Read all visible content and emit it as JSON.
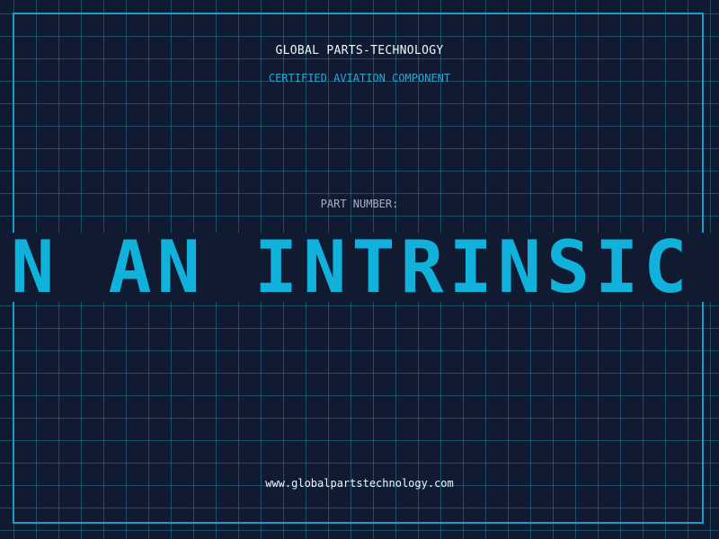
{
  "header": {
    "company": "GLOBAL PARTS-TECHNOLOGY",
    "subtitle": "CERTIFIED AVIATION COMPONENT"
  },
  "part": {
    "label": "PART NUMBER:",
    "value": "IN AN INTRINSIC SEMI"
  },
  "footer": {
    "url": "www.globalpartstechnology.com"
  },
  "colors": {
    "background": "#101a30",
    "accent": "#10b2dc",
    "frame": "#1e9bc6",
    "text": "#f2f4f7"
  }
}
